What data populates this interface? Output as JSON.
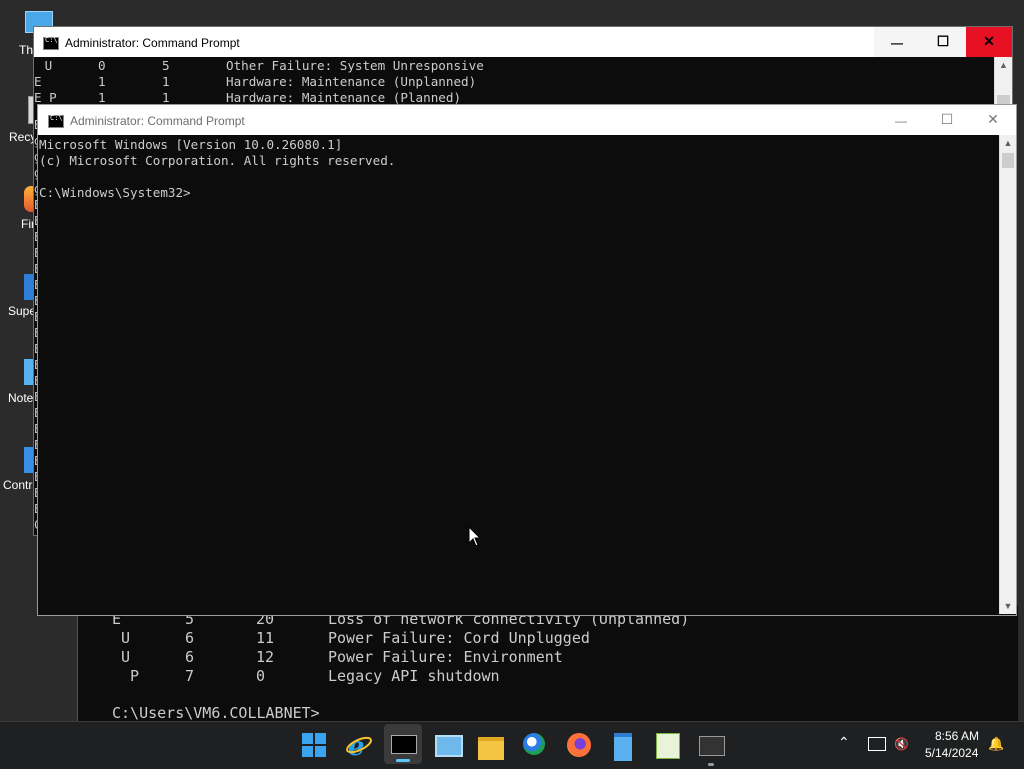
{
  "desktop": {
    "icons": [
      {
        "label": "Th",
        "icon": "this-pc-icon"
      },
      {
        "label": "Recy",
        "icon": "recycle-bin-icon"
      },
      {
        "label": "Fir",
        "icon": "firefox-shortcut-icon"
      },
      {
        "label": "Supe",
        "icon": "shortcut-icon"
      },
      {
        "label": "Note",
        "icon": "notepad-shortcut-icon"
      },
      {
        "label": "Contr",
        "icon": "control-panel-icon"
      }
    ]
  },
  "back_console": {
    "rows": [
      {
        "flag": "E",
        "major": "5",
        "minor": "20",
        "reason": "Loss of network connectivity (Unplanned)"
      },
      {
        "flag": " U",
        "major": "6",
        "minor": "11",
        "reason": "Power Failure: Cord Unplugged"
      },
      {
        "flag": " U",
        "major": "6",
        "minor": "12",
        "reason": "Power Failure: Environment"
      },
      {
        "flag": "  P",
        "major": "7",
        "minor": "0",
        "reason": "Legacy API shutdown"
      }
    ],
    "prompt": "C:\\Users\\VM6.COLLABNET>"
  },
  "window_middle": {
    "title": "Administrator: Command Prompt",
    "rows": [
      {
        "flag": " U",
        "major": "0",
        "minor": "5",
        "reason": "Other Failure: System Unresponsive"
      },
      {
        "flag": "E",
        "major": "1",
        "minor": "1",
        "reason": "Hardware: Maintenance (Unplanned)"
      },
      {
        "flag": "E P",
        "major": "1",
        "minor": "1",
        "reason": "Hardware: Maintenance (Planned)"
      }
    ],
    "left_edge_chars": [
      "B",
      "g",
      "g",
      "g",
      "g",
      "E",
      "E",
      "E",
      "E",
      "E",
      "E",
      "E",
      "E",
      "E",
      "E",
      "E",
      "E",
      "E",
      "E",
      "E",
      "E",
      "E",
      "E",
      "E",
      "E",
      "C"
    ],
    "buttons": {
      "minimize": "—",
      "maximize": "☐",
      "close": "✕"
    }
  },
  "window_front": {
    "title": "Administrator: Command Prompt",
    "lines": [
      "Microsoft Windows [Version 10.0.26080.1]",
      "(c) Microsoft Corporation. All rights reserved.",
      "",
      "C:\\Windows\\System32>"
    ],
    "buttons": {
      "minimize": "—",
      "maximize": "☐",
      "close": "✕"
    }
  },
  "taskbar": {
    "apps": [
      "start-icon",
      "internet-explorer-icon",
      "command-prompt-icon",
      "remote-desktop-icon",
      "file-explorer-icon",
      "browser-icon",
      "firefox-icon",
      "notepad-icon",
      "chart-app-icon",
      "terminal-icon"
    ],
    "clock": {
      "time": "8:56 AM",
      "date": "5/14/2024"
    }
  },
  "colors": {
    "terminal_bg": "#0c0c0c",
    "terminal_text": "#cccccc",
    "close_red": "#e81123",
    "taskbar_bg": "#1f2021"
  }
}
